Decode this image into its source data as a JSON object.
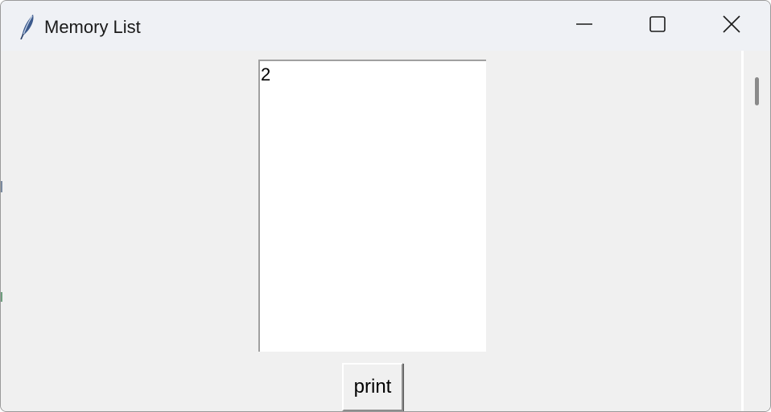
{
  "window": {
    "title": "Memory List",
    "icon": "feather-icon",
    "controls": {
      "minimize": "minimize-icon",
      "maximize": "maximize-icon",
      "close": "close-icon"
    }
  },
  "listbox": {
    "items": [
      "2"
    ]
  },
  "buttons": {
    "print_label": "print"
  },
  "colors": {
    "titlebar_bg": "#eff1f5",
    "client_bg": "#f0f0f0",
    "listbox_bg": "#ffffff",
    "scroll_thumb": "#8a8a8a"
  }
}
